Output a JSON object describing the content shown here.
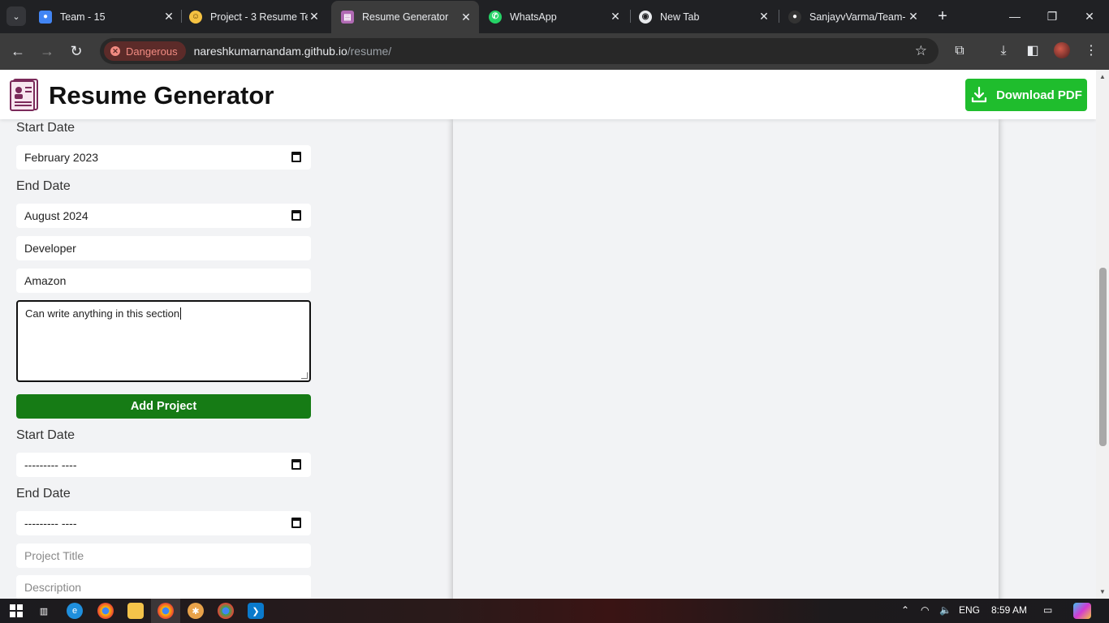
{
  "browser": {
    "tabs": [
      {
        "title": "Team - 15",
        "icon": "contacts-icon",
        "color": "#4285f4"
      },
      {
        "title": "Project - 3 Resume Te",
        "icon": "emoji-icon",
        "color": "#f5c242"
      },
      {
        "title": "Resume Generator",
        "icon": "resume-icon",
        "color": "#b06ab3"
      },
      {
        "title": "WhatsApp",
        "icon": "whatsapp-icon",
        "color": "#25d366"
      },
      {
        "title": "New Tab",
        "icon": "chrome-icon",
        "color": "#e8eaed"
      },
      {
        "title": "SanjayvVarma/Team-",
        "icon": "github-icon",
        "color": "#e8eaed"
      }
    ],
    "security_label": "Dangerous",
    "url_host": "nareshkumarnandam.github.io",
    "url_path": "/resume/"
  },
  "app": {
    "title": "Resume Generator",
    "download_label": "Download PDF",
    "accent": "#1fbd2d"
  },
  "form": {
    "start_date_label_1": "Start Date",
    "start_date_value_1": "February  2023",
    "end_date_label_1": "End Date",
    "end_date_value_1": "August  2024",
    "role_value": "Developer",
    "company_value": "Amazon",
    "description_value": "Can write anything in this section",
    "add_project_label": "Add Project",
    "start_date_label_2": "Start Date",
    "start_date_value_2": "--------- ----",
    "end_date_label_2": "End Date",
    "end_date_value_2": "--------- ----",
    "project_title_placeholder": "Project Title",
    "description_placeholder": "Description"
  },
  "taskbar": {
    "language": "ENG",
    "time": "8:59 AM"
  }
}
